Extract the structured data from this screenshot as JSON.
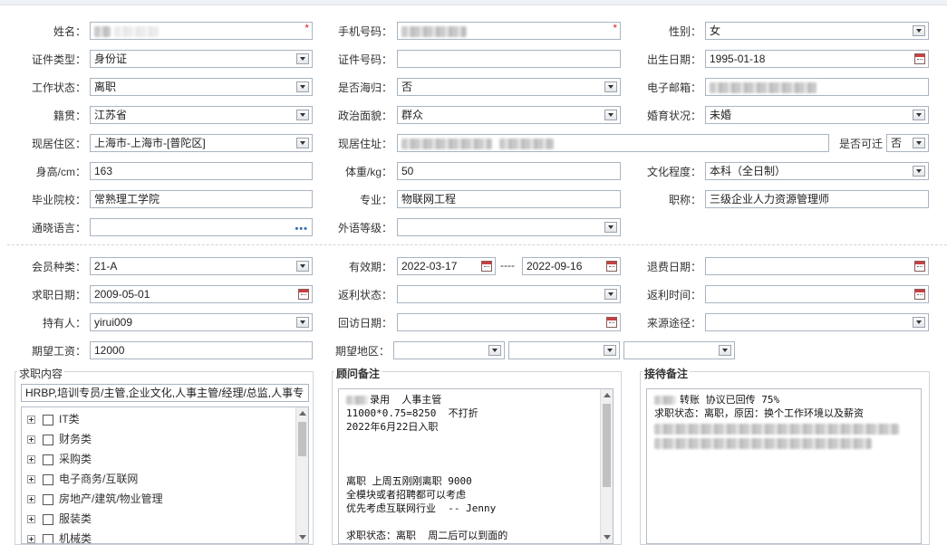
{
  "form": {
    "name": {
      "label": "姓名："
    },
    "phone": {
      "label": "手机号码："
    },
    "gender": {
      "label": "性别：",
      "value": "女"
    },
    "id_type": {
      "label": "证件类型：",
      "value": "身份证"
    },
    "id_no": {
      "label": "证件号码：",
      "value": ""
    },
    "birth": {
      "label": "出生日期：",
      "value": "1995-01-18"
    },
    "work_status": {
      "label": "工作状态：",
      "value": "离职"
    },
    "overseas": {
      "label": "是否海归：",
      "value": "否"
    },
    "email": {
      "label": "电子邮箱："
    },
    "native": {
      "label": "籍贯：",
      "value": "江苏省"
    },
    "political": {
      "label": "政治面貌：",
      "value": "群众"
    },
    "marital": {
      "label": "婚育状况：",
      "value": "未婚"
    },
    "residence": {
      "label": "现居住区：",
      "value": "上海市-上海市-[普陀区]"
    },
    "address": {
      "label": "现居住址："
    },
    "relocate": {
      "label": "是否可迁",
      "value": "否"
    },
    "height": {
      "label": "身高/cm：",
      "value": "163"
    },
    "weight": {
      "label": "体重/kg：",
      "value": "50"
    },
    "education": {
      "label": "文化程度：",
      "value": "本科（全日制）"
    },
    "school": {
      "label": "毕业院校：",
      "value": "常熟理工学院"
    },
    "major": {
      "label": "专业：",
      "value": "物联网工程"
    },
    "title": {
      "label": "职称：",
      "value": "三级企业人力资源管理师"
    },
    "languages": {
      "label": "通晓语言：",
      "value": ""
    },
    "lang_level": {
      "label": "外语等级：",
      "value": ""
    },
    "member_type": {
      "label": "会员种类：",
      "value": "21-A"
    },
    "validity": {
      "label": "有效期：",
      "from": "2022-03-17",
      "sep": "----",
      "to": "2022-09-16"
    },
    "refund_date": {
      "label": "退费日期：",
      "value": ""
    },
    "seek_date": {
      "label": "求职日期：",
      "value": "2009-05-01"
    },
    "rebate_status": {
      "label": "返利状态：",
      "value": ""
    },
    "rebate_time": {
      "label": "返利时间：",
      "value": ""
    },
    "holder": {
      "label": "持有人：",
      "value": "yirui009"
    },
    "visit_date": {
      "label": "回访日期：",
      "value": ""
    },
    "source": {
      "label": "来源途径：",
      "value": ""
    },
    "salary": {
      "label": "期望工资：",
      "value": "12000"
    },
    "region": {
      "label": "期望地区：",
      "values": [
        "",
        "",
        ""
      ]
    }
  },
  "job_content": {
    "title": "求职内容",
    "summary": "HRBP,培训专员/主管,企业文化,人事主管/经理/总监,人事专",
    "tree": [
      "IT类",
      "财务类",
      "采购类",
      "电子商务/互联网",
      "房地产/建筑/物业管理",
      "服装类",
      "机械类"
    ]
  },
  "advisor_note": {
    "title": "顾问备注",
    "lines": [
      "录用  人事主管",
      "11000*0.75=8250  不打折",
      "2022年6月22日入职",
      "",
      "",
      "",
      "离职 上周五刚刚离职 9000",
      "全模块或者招聘都可以考虑",
      "优先考虑互联网行业  -- Jenny",
      "",
      "求职状态：离职  周二后可以到面的"
    ]
  },
  "reception_note": {
    "title": "接待备注",
    "lines": [
      "转账 协议已回传 75%",
      "求职状态：离职，原因：换个工作环境以及薪资"
    ]
  }
}
